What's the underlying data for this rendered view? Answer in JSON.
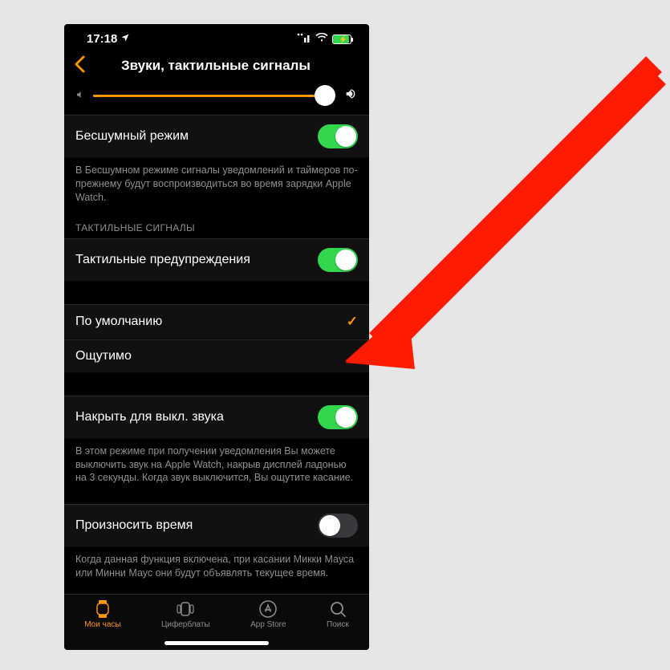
{
  "status": {
    "time": "17:18",
    "location_icon": "➤",
    "signal": "::!!",
    "wifi": "wifi",
    "battery_pct": 90
  },
  "nav": {
    "title": "Звуки, тактильные сигналы"
  },
  "slider": {
    "value": 100
  },
  "cells": {
    "silentMode": {
      "label": "Бесшумный режим",
      "on": true
    },
    "silentFooter": "В Бесшумном режиме сигналы уведомлений и таймеров по-прежнему будут воспроизводиться во время зарядки Apple Watch.",
    "hapticHeader": "ТАКТИЛЬНЫЕ СИГНАЛЫ",
    "hapticAlerts": {
      "label": "Тактильные предупреждения",
      "on": true
    },
    "defaultOption": {
      "label": "По умолчанию",
      "checked": true
    },
    "prominent": {
      "label": "Ощутимо",
      "checked": false
    },
    "coverToMute": {
      "label": "Накрыть для выкл. звука",
      "on": true
    },
    "coverFooter": "В этом режиме при получении уведомления Вы можете выключить звук на Apple Watch, накрыв дисплей ладонью на 3 секунды. Когда звук выключится, Вы ощутите касание.",
    "speakTime": {
      "label": "Произносить время",
      "on": false
    },
    "speakFooter": "Когда данная функция включена, при касании Микки Мауса или Минни Маус они будут объявлять текущее время."
  },
  "tabs": {
    "myWatch": "Мои часы",
    "faces": "Циферблаты",
    "appStore": "App Store",
    "search": "Поиск"
  }
}
